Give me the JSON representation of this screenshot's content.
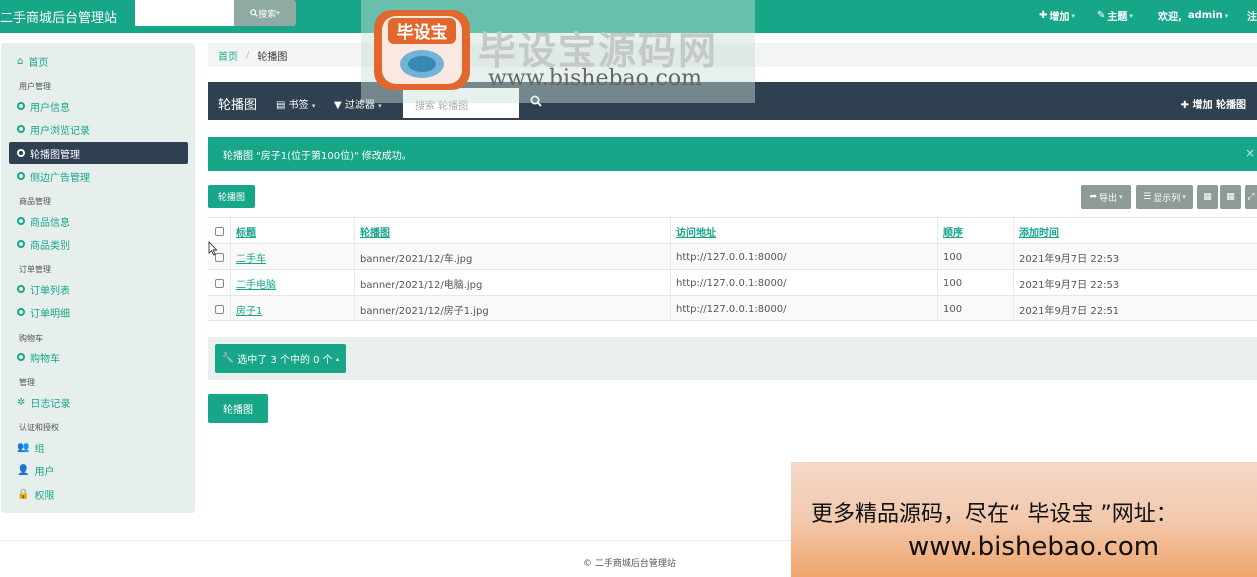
{
  "header": {
    "brand": "二手商城后台管理站",
    "search_button": "搜索",
    "add_label": "增加",
    "theme_label": "主题",
    "welcome": "欢迎,",
    "user": "admin",
    "trailing": "注"
  },
  "sidebar": {
    "home": "首页",
    "groups": [
      {
        "title": "用户管理",
        "items": [
          "用户信息",
          "用户浏览记录",
          "轮播图管理",
          "侧边广告管理"
        ]
      },
      {
        "title": "商品管理",
        "items": [
          "商品信息",
          "商品类别"
        ]
      },
      {
        "title": "订单管理",
        "items": [
          "订单列表",
          "订单明细"
        ]
      },
      {
        "title": "购物车",
        "items": [
          "购物车"
        ]
      },
      {
        "title": "管理",
        "items": [
          "日志记录"
        ]
      },
      {
        "title": "认证和授权",
        "items": [
          "组",
          "用户",
          "权限"
        ]
      }
    ],
    "active": "轮播图管理"
  },
  "breadcrumb": {
    "home": "首页",
    "sep": "/",
    "current": "轮播图"
  },
  "toolbar": {
    "title": "轮播图",
    "bookmarks": "书签",
    "filter": "过滤器",
    "search_placeholder": "搜索 轮播图",
    "add": "增加 轮播图"
  },
  "alert": {
    "message": "轮播图 \"房子1(位于第100位)\" 修改成功。",
    "close": "×"
  },
  "actions": {
    "top_button": "轮播图",
    "export": "导出",
    "columns": "显示列",
    "bulk": "选中了 3 个中的 0 个",
    "bottom_button": "轮播图"
  },
  "table": {
    "columns": [
      "标题",
      "轮播图",
      "访问地址",
      "顺序",
      "添加时间"
    ],
    "rows": [
      {
        "title": "二手车",
        "image": "banner/2021/12/车.jpg",
        "url": "http://127.0.0.1:8000/",
        "order": "100",
        "time": "2021年9月7日 22:53"
      },
      {
        "title": "二手电脑",
        "image": "banner/2021/12/电脑.jpg",
        "url": "http://127.0.0.1:8000/",
        "order": "100",
        "time": "2021年9月7日 22:53"
      },
      {
        "title": "房子1",
        "image": "banner/2021/12/房子1.jpg",
        "url": "http://127.0.0.1:8000/",
        "order": "100",
        "time": "2021年9月7日 22:51"
      }
    ]
  },
  "footer": "© 二手商城后台管理站",
  "watermark": {
    "badge": "毕设宝",
    "title": "毕设宝源码网",
    "url": "www.bishebao.com",
    "promo_line1": "更多精品源码，尽在“ 毕设宝 ”网址：",
    "promo_line2": "www.bishebao.com"
  },
  "colors": {
    "accent": "#18a689",
    "dark": "#2f4050",
    "gray_button": "#8e9a97"
  }
}
